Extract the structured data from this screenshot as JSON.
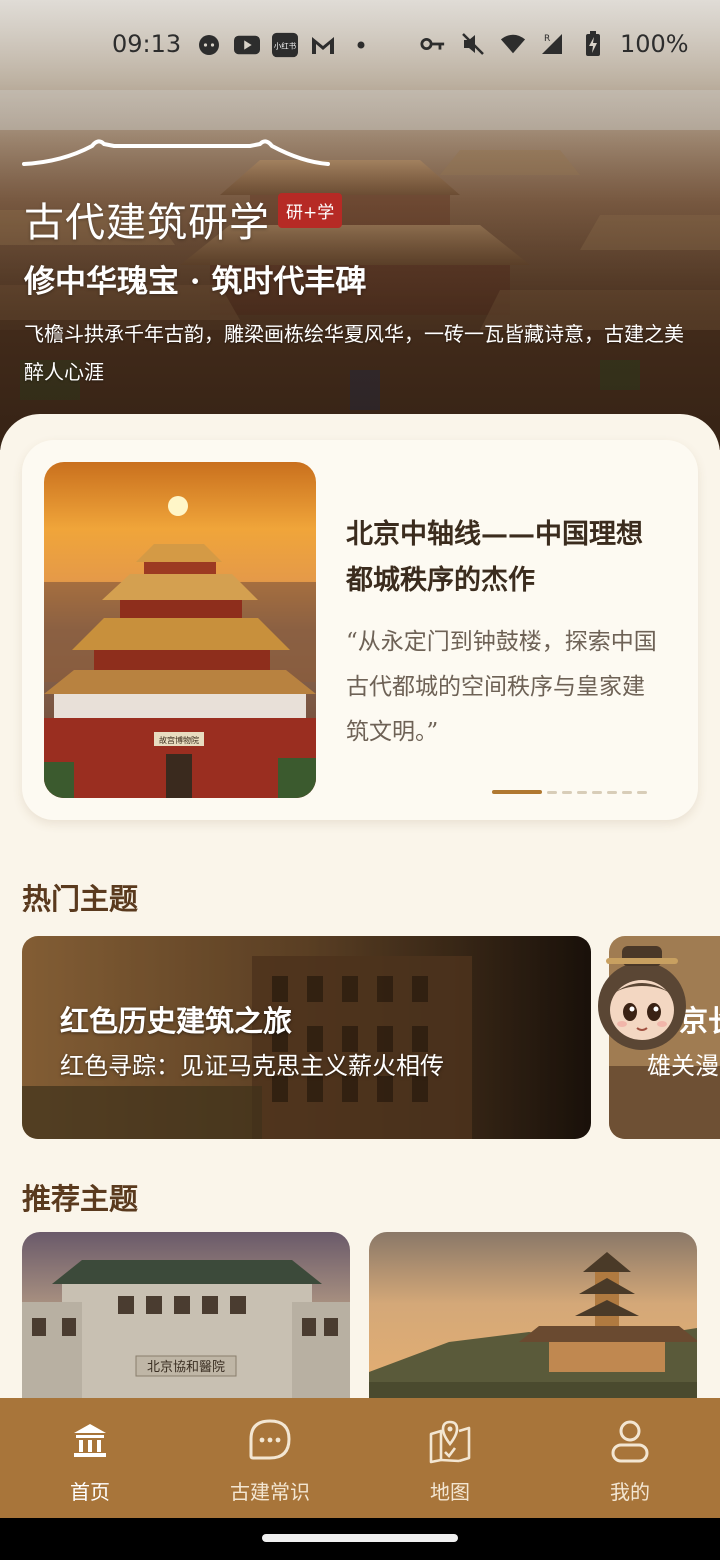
{
  "status_bar": {
    "time": "09:13",
    "battery": "100%",
    "icons": [
      "face-icon",
      "youtube-icon",
      "xiaohongshu-icon",
      "gmail-icon",
      "dot-icon",
      "vpn-key-icon",
      "mute-icon",
      "wifi-icon",
      "signal-icon",
      "battery-icon"
    ],
    "xhs_label": "小红书"
  },
  "hero": {
    "title": "古代建筑研学",
    "badge": "研+学",
    "slogan": "修中华瑰宝 · 筑时代丰碑",
    "intro": "飞檐斗拱承千年古韵，雕梁画栋绘华夏风华，一砖一瓦皆藏诗意，古建之美醉人心涯"
  },
  "feature": {
    "title": "北京中轴线——中国理想都城秩序的杰作",
    "quote": "“从永定门到钟鼓楼，探索中国古代都城的空间秩序与皇家建筑文明。”",
    "plaque": "故宫博物院",
    "carousel": {
      "active_index": 0,
      "total": 8
    }
  },
  "hot_section": {
    "title": "热门主题",
    "cards": [
      {
        "title": "红色历史建筑之旅",
        "subtitle": "红色寻踪：见证马克思主义薪火相传"
      },
      {
        "title": "京长",
        "subtitle": "雄关漫"
      }
    ]
  },
  "rec_section": {
    "title": "推荐主题",
    "cards": [
      {
        "image": "peking-union-medical-college",
        "plaque": "北京協和醫院"
      },
      {
        "image": "summer-palace-tower"
      }
    ]
  },
  "tabbar": {
    "items": [
      {
        "label": "首页",
        "icon": "temple-icon",
        "active": true
      },
      {
        "label": "古建常识",
        "icon": "chat-bubble-icon",
        "active": false
      },
      {
        "label": "地图",
        "icon": "map-pin-icon",
        "active": false
      },
      {
        "label": "我的",
        "icon": "user-icon",
        "active": false
      }
    ]
  },
  "colors": {
    "accent": "#a8753a",
    "badge": "#b62a25",
    "background": "#faf5ea",
    "section_title": "#5a3a1e"
  }
}
